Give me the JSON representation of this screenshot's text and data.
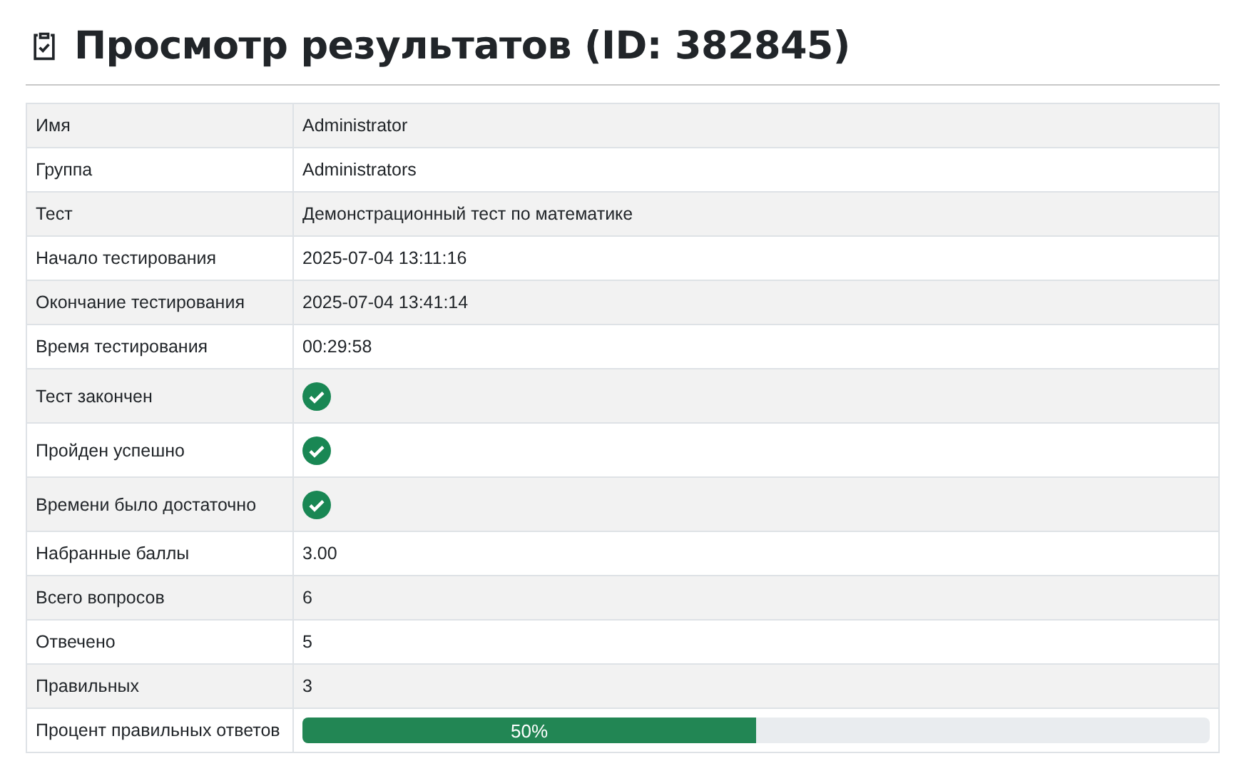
{
  "title": "Просмотр результатов (ID: 382845)",
  "rows": [
    {
      "label": "Имя",
      "kind": "text",
      "value": "Administrator"
    },
    {
      "label": "Группа",
      "kind": "text",
      "value": "Administrators"
    },
    {
      "label": "Тест",
      "kind": "text",
      "value": "Демонстрационный тест по математике"
    },
    {
      "label": "Начало тестирования",
      "kind": "text",
      "value": "2025-07-04 13:11:16"
    },
    {
      "label": "Окончание тестирования",
      "kind": "text",
      "value": "2025-07-04 13:41:14"
    },
    {
      "label": "Время тестирования",
      "kind": "text",
      "value": "00:29:58"
    },
    {
      "label": "Тест закончен",
      "kind": "check",
      "checked": true
    },
    {
      "label": "Пройден успешно",
      "kind": "check",
      "checked": true
    },
    {
      "label": "Времени было достаточно",
      "kind": "check",
      "checked": true
    },
    {
      "label": "Набранные баллы",
      "kind": "text",
      "value": "3.00"
    },
    {
      "label": "Всего вопросов",
      "kind": "text",
      "value": "6"
    },
    {
      "label": "Отвечено",
      "kind": "text",
      "value": "5"
    },
    {
      "label": "Правильных",
      "kind": "text",
      "value": "3"
    },
    {
      "label": "Процент правильных ответов",
      "kind": "progress",
      "level": 0.5,
      "value": "50%"
    }
  ]
}
